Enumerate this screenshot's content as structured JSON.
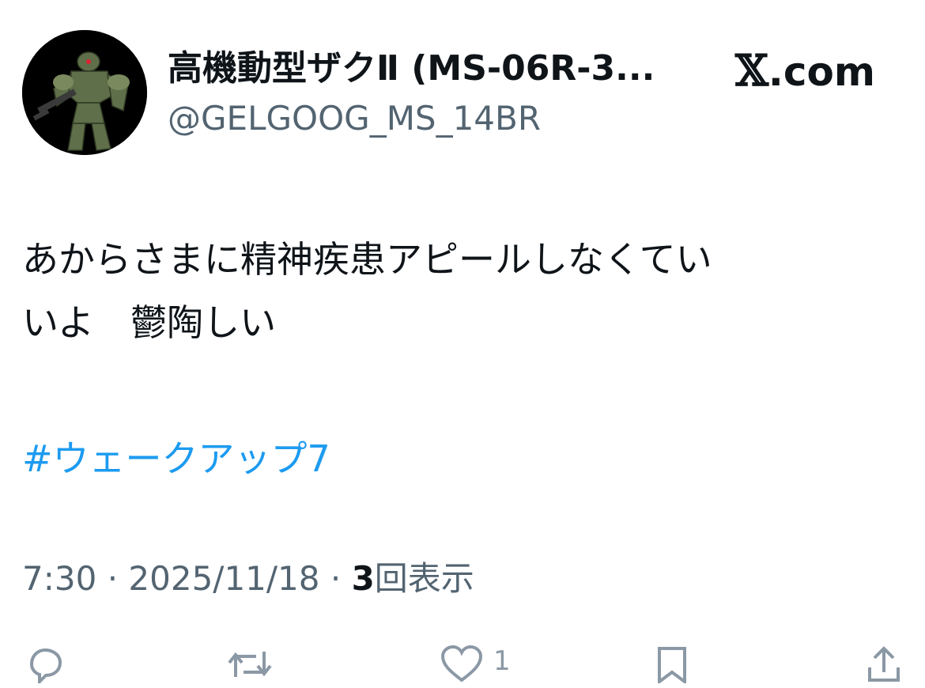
{
  "tweet": {
    "author": {
      "display_name": "高機動型ザクⅡ (MS-06R-3...",
      "handle": "@GELGOOG_MS_14BR",
      "avatar_icon": "mobile-suit-avatar-icon"
    },
    "site": {
      "x_mark": "𝕏",
      "domain_suffix": ".com"
    },
    "text": "あからさまに精神疾患アピールしなくてい\nいよ　鬱陶しい",
    "hashtag": "#ウェークアップ7",
    "meta": {
      "time": "7:30",
      "separator": "·",
      "date": "2025/11/18",
      "views_count": "3",
      "views_label": "回表示"
    },
    "actions": {
      "reply_icon": "reply-icon",
      "retweet_icon": "retweet-icon",
      "like_icon": "like-icon",
      "like_count": "1",
      "bookmark_icon": "bookmark-icon",
      "share_icon": "share-icon"
    }
  }
}
